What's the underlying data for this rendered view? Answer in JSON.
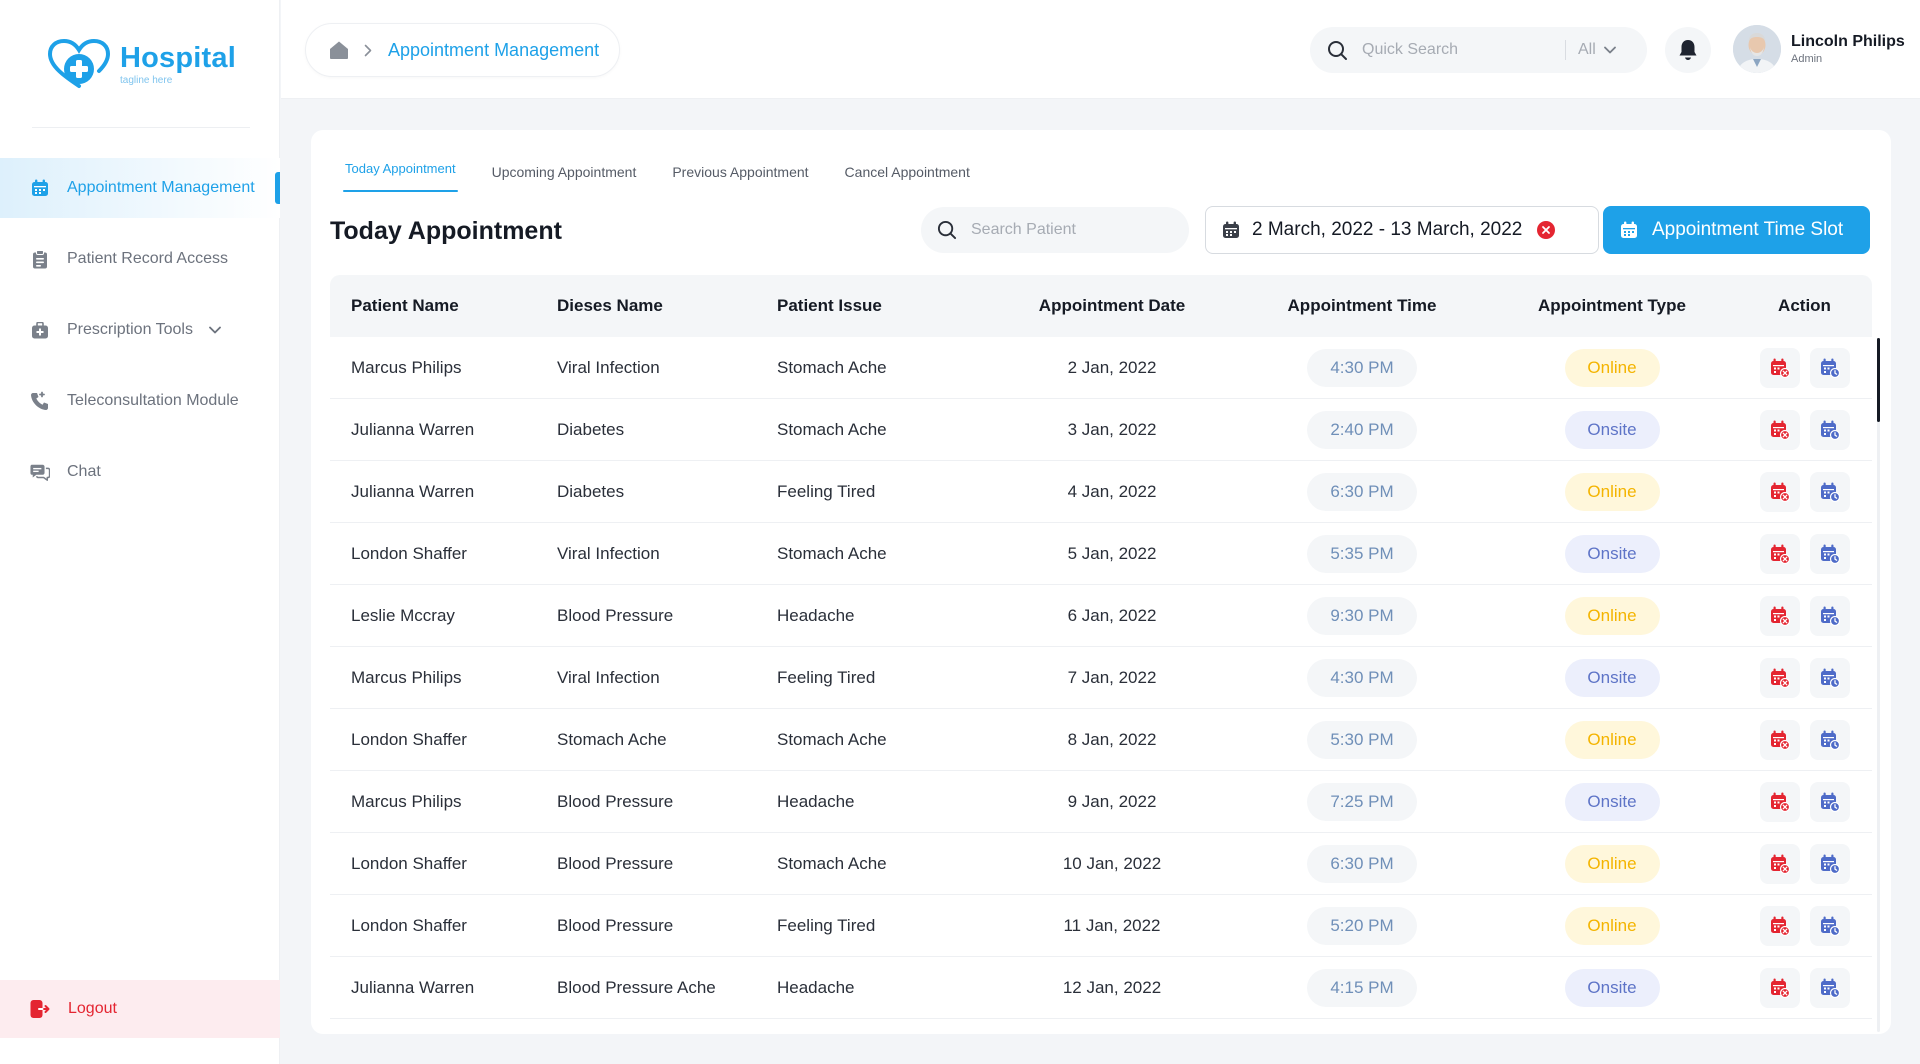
{
  "brand": {
    "name": "Hospital",
    "tagline": "tagline here",
    "color": "#1EA1E8"
  },
  "sidebar": {
    "items": [
      {
        "label": "Appointment Management",
        "icon": "calendar-icon",
        "active": true
      },
      {
        "label": "Patient Record Access",
        "icon": "clipboard-icon"
      },
      {
        "label": "Prescription Tools",
        "icon": "medical-bag-icon",
        "has_dropdown": true
      },
      {
        "label": "Teleconsultation Module",
        "icon": "phone-icon"
      },
      {
        "label": "Chat",
        "icon": "chat-icon"
      }
    ],
    "logout": {
      "label": "Logout",
      "icon": "logout-icon",
      "color": "#E42531"
    }
  },
  "header": {
    "breadcrumb": "Appointment Management",
    "search": {
      "placeholder": "Quick Search",
      "filter": "All"
    },
    "user": {
      "name": "Lincoln Philips",
      "role": "Admin"
    }
  },
  "main": {
    "tabs": [
      "Today Appointment",
      "Upcoming Appointment",
      "Previous Appointment",
      "Cancel Appointment"
    ],
    "active_tab": 0,
    "title": "Today Appointment",
    "patient_search": {
      "placeholder": "Search Patient"
    },
    "date_range": "2 March, 2022 - 13 March, 2022",
    "slot_button": "Appointment Time Slot",
    "table": {
      "columns": [
        "Patient Name",
        "Dieses Name",
        "Patient Issue",
        "Appointment Date",
        "Appointment Time",
        "Appointment Type",
        "Action"
      ],
      "rows": [
        [
          "Marcus Philips",
          "Viral Infection",
          "Stomach Ache",
          "2 Jan, 2022",
          "4:30 PM",
          "Online"
        ],
        [
          "Julianna Warren",
          "Diabetes",
          "Stomach Ache",
          "3 Jan, 2022",
          "2:40 PM",
          "Onsite"
        ],
        [
          "Julianna Warren",
          "Diabetes",
          "Feeling Tired",
          "4 Jan, 2022",
          "6:30 PM",
          "Online"
        ],
        [
          "London Shaffer",
          "Viral Infection",
          "Stomach Ache",
          "5 Jan, 2022",
          "5:35 PM",
          "Onsite"
        ],
        [
          "Leslie Mccray",
          "Blood Pressure",
          "Headache",
          "6 Jan, 2022",
          "9:30 PM",
          "Online"
        ],
        [
          "Marcus Philips",
          "Viral Infection",
          "Feeling Tired",
          "7 Jan, 2022",
          "4:30 PM",
          "Onsite"
        ],
        [
          "London Shaffer",
          "Stomach Ache",
          "Stomach Ache",
          "8 Jan, 2022",
          "5:30 PM",
          "Online"
        ],
        [
          "Marcus Philips",
          "Blood Pressure",
          "Headache",
          "9 Jan, 2022",
          "7:25 PM",
          "Onsite"
        ],
        [
          "London Shaffer",
          "Blood Pressure",
          "Stomach Ache",
          "10 Jan, 2022",
          "6:30 PM",
          "Online"
        ],
        [
          "London Shaffer",
          "Blood Pressure",
          "Feeling Tired",
          "11 Jan, 2022",
          "5:20 PM",
          "Online"
        ],
        [
          "Julianna Warren",
          "Blood Pressure Ache",
          "Headache",
          "12 Jan, 2022",
          "4:15 PM",
          "Onsite"
        ]
      ],
      "action_icons": [
        "cancel-appointment-icon",
        "reschedule-appointment-icon"
      ]
    }
  },
  "colors": {
    "accent": "#1EA1E8",
    "online": "#F4B400",
    "onsite": "#5E74C7",
    "danger": "#E42531"
  }
}
